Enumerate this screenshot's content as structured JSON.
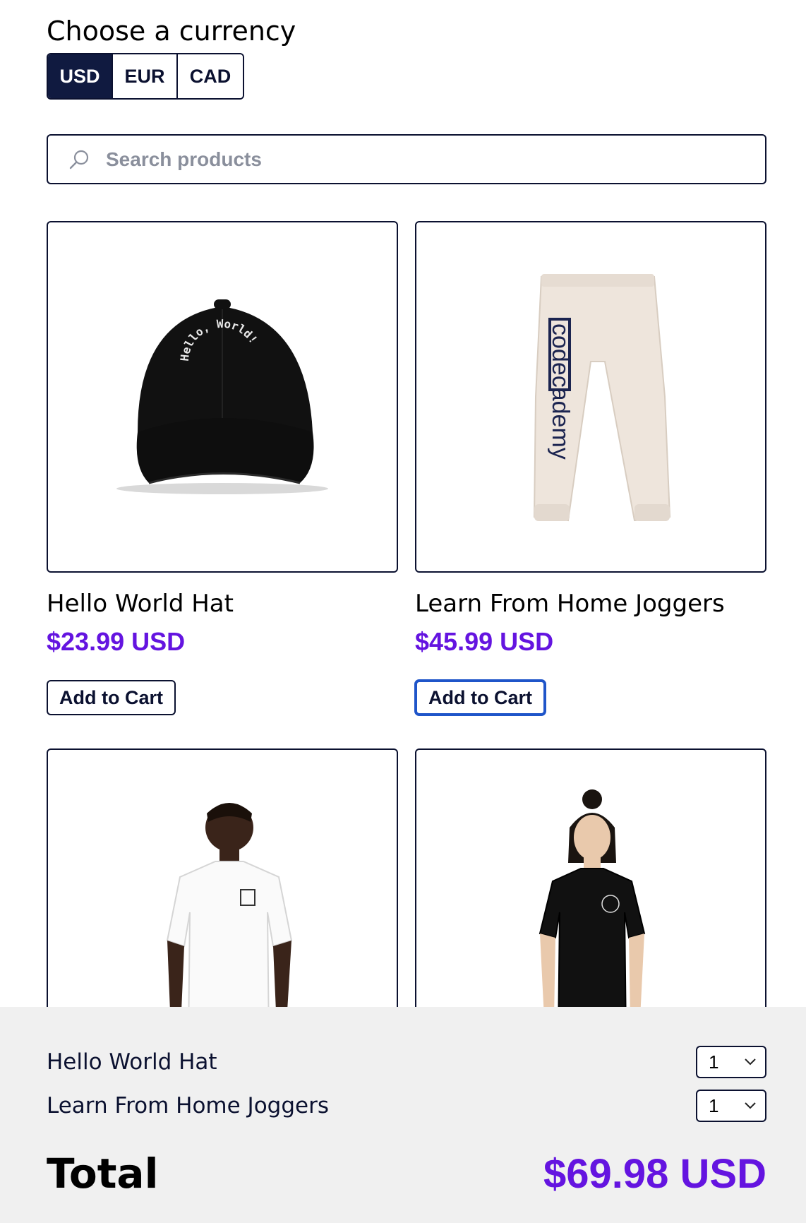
{
  "currency": {
    "heading": "Choose a currency",
    "options": [
      "USD",
      "EUR",
      "CAD"
    ],
    "selected": "USD"
  },
  "search": {
    "placeholder": "Search products",
    "value": ""
  },
  "products": [
    {
      "name": "Hello World Hat",
      "price": "$23.99 USD",
      "button": "Add to Cart",
      "hat_text": "Hello, World!"
    },
    {
      "name": "Learn From Home Joggers",
      "price": "$45.99 USD",
      "button": "Add to Cart",
      "leg_text": "codecademy"
    },
    {
      "name": "",
      "price": "",
      "button": ""
    },
    {
      "name": "",
      "price": "",
      "button": ""
    }
  ],
  "cart": {
    "items": [
      {
        "name": "Hello World Hat",
        "qty": "1"
      },
      {
        "name": "Learn From Home Joggers",
        "qty": "1"
      }
    ],
    "total_label": "Total",
    "total_value": "$69.98 USD"
  },
  "colors": {
    "accent": "#6414e0",
    "navy": "#101a40",
    "focus": "#1f55c9",
    "cart_bg": "#f0f0f0"
  }
}
